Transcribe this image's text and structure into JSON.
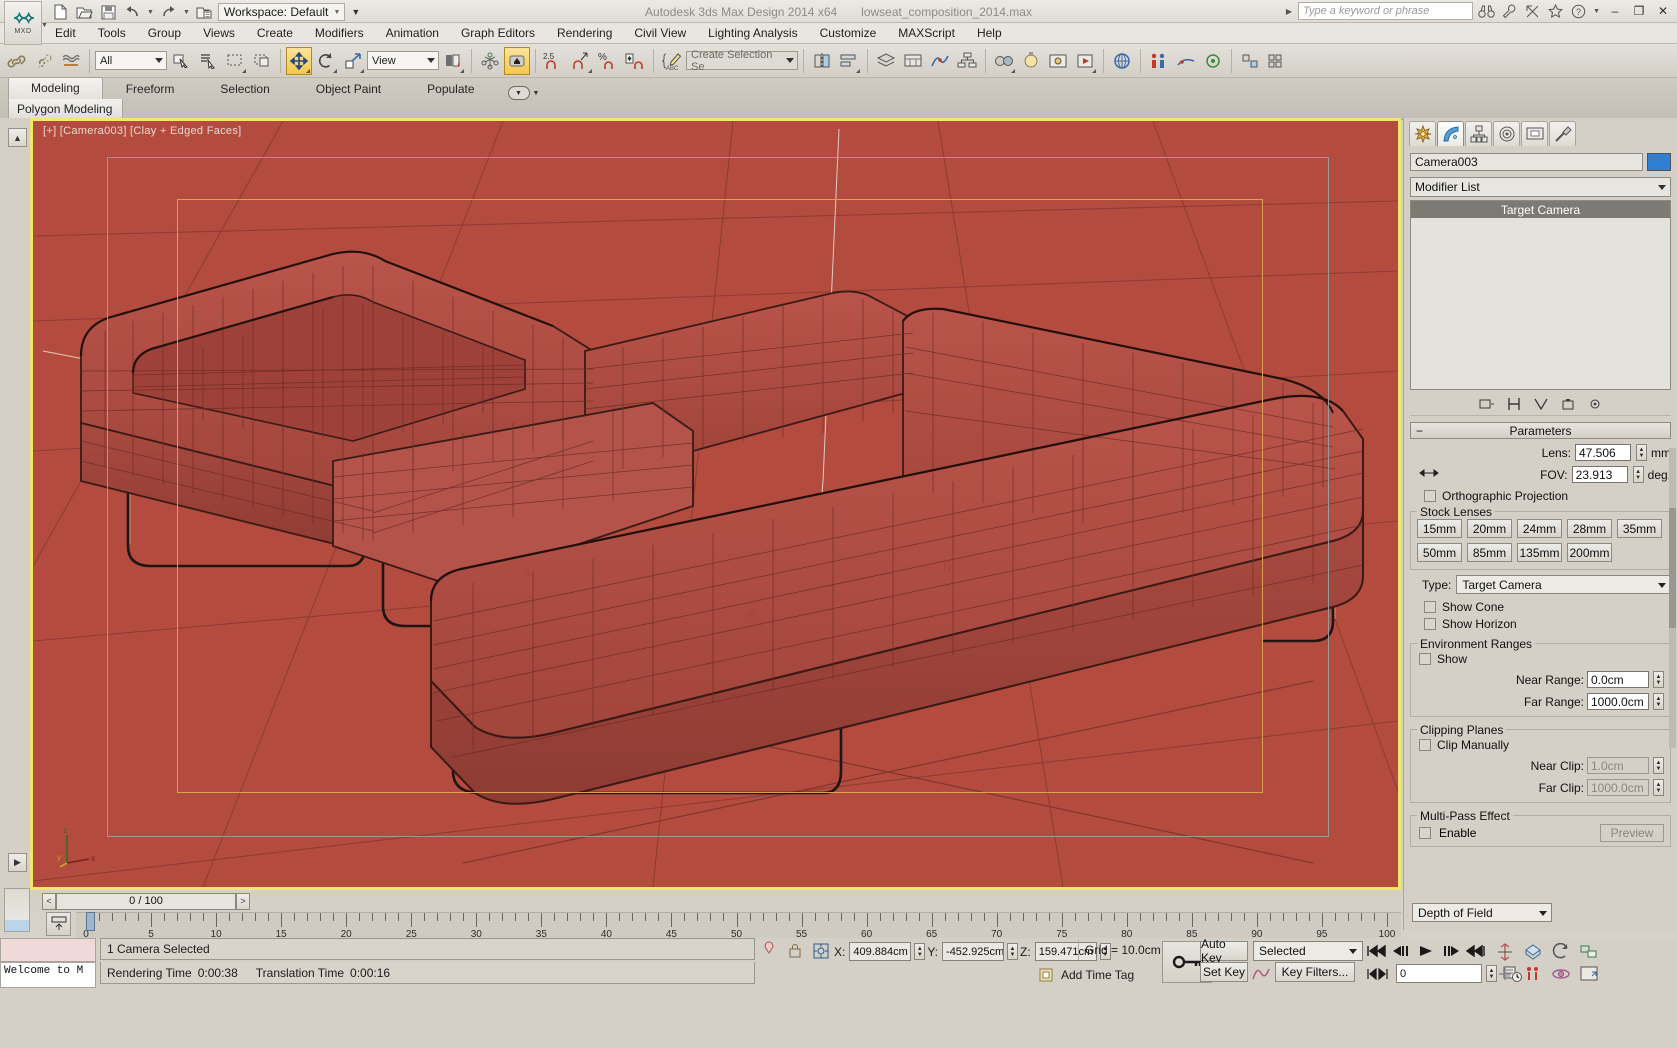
{
  "app": {
    "product_title": "Autodesk 3ds Max Design 2014 x64",
    "file_name": "lowseat_composition_2014.max",
    "logo_text": "MXD"
  },
  "quick_access": {
    "workspace_label": "Workspace: Default",
    "items": [
      "new-icon",
      "open-icon",
      "save-icon",
      "undo-icon",
      "redo-icon",
      "set-project-icon"
    ]
  },
  "search": {
    "placeholder": "Type a keyword or phrase",
    "value": ""
  },
  "titlebar_right_icons": [
    "binoculars-icon",
    "wrench-icon",
    "exchange-icon",
    "star-icon",
    "help-icon"
  ],
  "window_buttons": {
    "minimize": "–",
    "restore": "❐",
    "close": "✕"
  },
  "menu": {
    "items": [
      "Edit",
      "Tools",
      "Group",
      "Views",
      "Create",
      "Modifiers",
      "Animation",
      "Graph Editors",
      "Rendering",
      "Civil View",
      "Lighting Analysis",
      "Customize",
      "MAXScript",
      "Help"
    ]
  },
  "toolbar": {
    "selection_filter": "All",
    "ref_coord_system": "View",
    "named_selection_set": "Create Selection Se",
    "angle_snap_value": "2.5"
  },
  "ribbon": {
    "tabs": [
      "Modeling",
      "Freeform",
      "Selection",
      "Object Paint",
      "Populate"
    ],
    "selected_tab": "Modeling",
    "panel_label": "Polygon Modeling"
  },
  "viewport": {
    "label": "[+] [Camera003] [Clay + Edged Faces]",
    "axis_labels": {
      "z": "z",
      "x": "x",
      "y": "y"
    },
    "background_color": "#b34c3f",
    "active_border_color": "#f2e96b",
    "render_frame_color": "#d9a24f",
    "safe_frame_color": "#9a9a9a"
  },
  "command_panel": {
    "tabs": [
      "create-tab-icon",
      "modify-tab-icon",
      "hierarchy-tab-icon",
      "motion-tab-icon",
      "display-tab-icon",
      "utilities-tab-icon"
    ],
    "selected_tab_index": 1,
    "object_name": "Camera003",
    "object_color": "#2f7fd4",
    "modifier_list_label": "Modifier List",
    "stack_items": [
      "Target Camera"
    ],
    "rollup": {
      "title": "Parameters",
      "lens_label": "Lens:",
      "lens_value": "47.506",
      "lens_unit": "mm",
      "fov_label": "FOV:",
      "fov_value": "23.913",
      "fov_unit": "deg.",
      "orthographic_label": "Orthographic Projection",
      "orthographic_checked": false,
      "stock_lenses_label": "Stock Lenses",
      "stock_lenses": [
        "15mm",
        "20mm",
        "24mm",
        "28mm",
        "35mm",
        "50mm",
        "85mm",
        "135mm",
        "200mm"
      ],
      "type_label": "Type:",
      "type_value": "Target Camera",
      "show_cone_label": "Show Cone",
      "show_cone_checked": false,
      "show_horizon_label": "Show Horizon",
      "show_horizon_checked": false,
      "env_ranges_label": "Environment Ranges",
      "env_show_label": "Show",
      "env_show_checked": false,
      "near_range_label": "Near Range:",
      "near_range_value": "0.0cm",
      "far_range_label": "Far Range:",
      "far_range_value": "1000.0cm",
      "clipping_planes_label": "Clipping Planes",
      "clip_manually_label": "Clip Manually",
      "clip_manually_checked": false,
      "near_clip_label": "Near Clip:",
      "near_clip_value": "1.0cm",
      "far_clip_label": "Far Clip:",
      "far_clip_value": "1000.0cm",
      "multipass_label": "Multi-Pass Effect",
      "enable_label": "Enable",
      "enable_checked": false,
      "preview_label": "Preview",
      "effect_value": "Depth of Field"
    }
  },
  "timeline": {
    "frame_readout": "0 / 100",
    "prev_label": "<",
    "next_label": ">",
    "ruler_labels": [
      "5",
      "10",
      "15",
      "20",
      "25",
      "30",
      "35",
      "40",
      "45",
      "50",
      "55",
      "60",
      "65",
      "70",
      "75",
      "80",
      "85",
      "90",
      "95",
      "100"
    ],
    "ruler_start": 0,
    "ruler_end": 100,
    "current_frame": 0
  },
  "status": {
    "selection_text": "1 Camera Selected",
    "render_time_label": "Rendering Time",
    "render_time": "0:00:38",
    "translation_time_label": "Translation Time",
    "translation_time": "0:00:16",
    "maxscript_listener": "Welcome to M",
    "coords": {
      "x_label": "X:",
      "x_value": "409.884cm",
      "y_label": "Y:",
      "y_value": "-452.925cm",
      "z_label": "Z:",
      "z_value": "159.471cm"
    },
    "grid_info": "Grid = 10.0cm",
    "add_time_tag": "Add Time Tag",
    "auto_key": "Auto Key",
    "set_key": "Set Key",
    "key_filters": "Key Filters...",
    "key_mode_selected": "Selected",
    "frame_field": "0"
  }
}
